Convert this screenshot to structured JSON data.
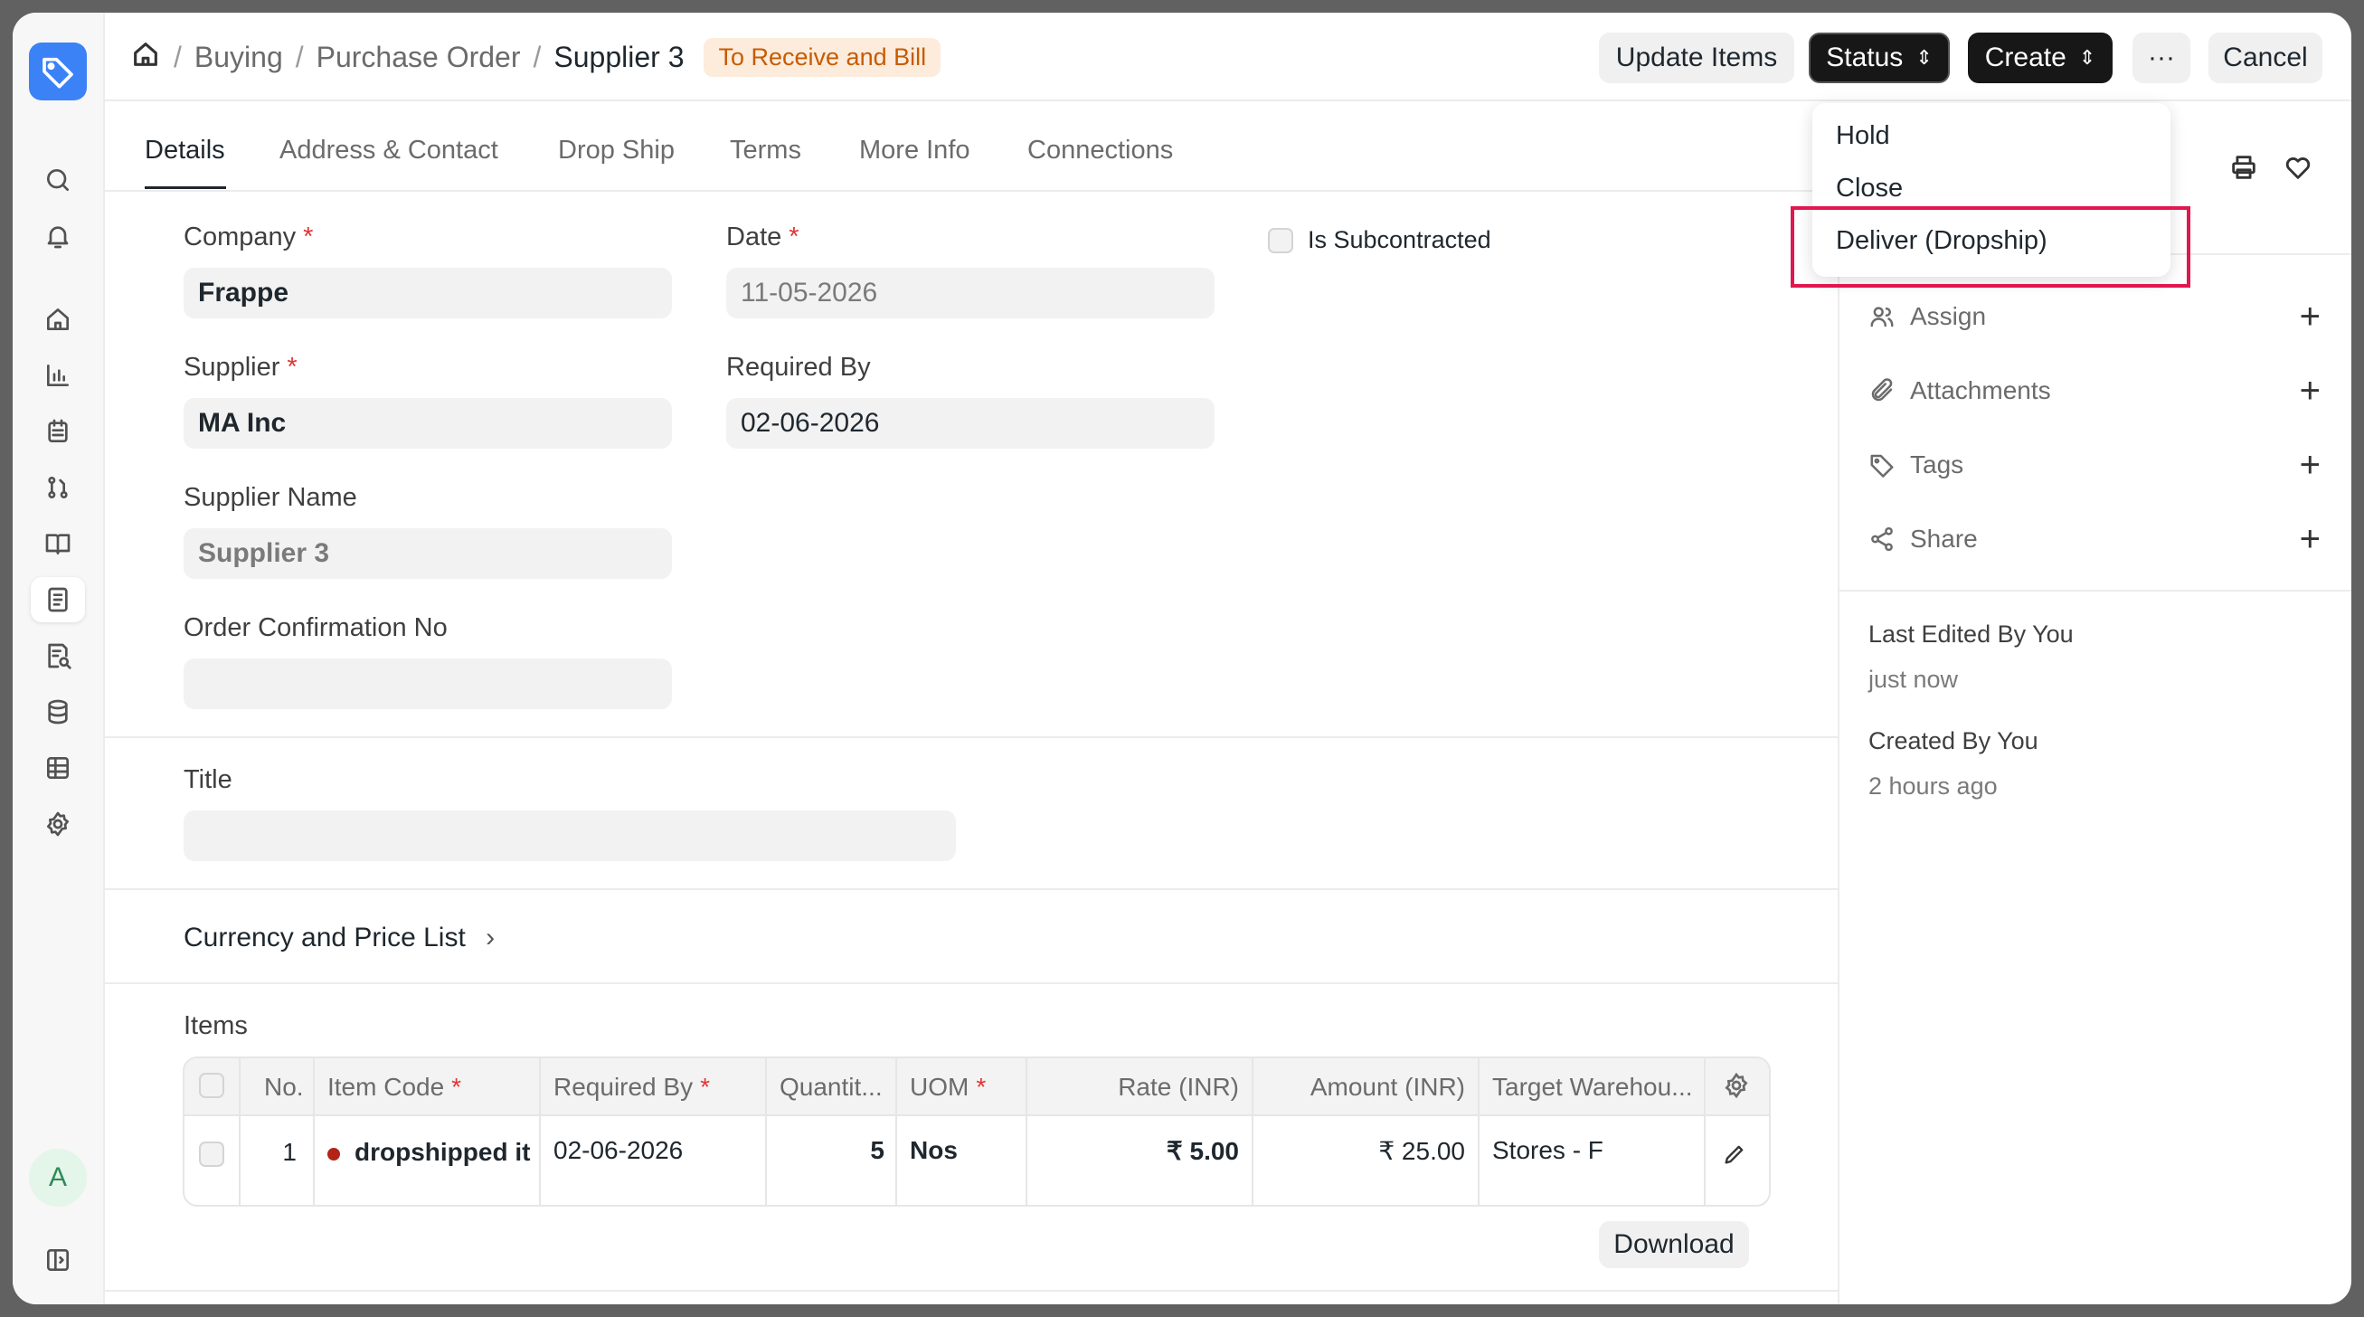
{
  "breadcrumb": {
    "items": [
      "Buying",
      "Purchase Order"
    ],
    "current": "Supplier 3",
    "status_pill": "To Receive and Bill"
  },
  "header_buttons": {
    "update_items": "Update Items",
    "status": "Status",
    "create": "Create",
    "more": "···",
    "cancel": "Cancel"
  },
  "status_menu": {
    "items": [
      "Hold",
      "Close",
      "Deliver (Dropship)"
    ],
    "highlighted": "Deliver (Dropship)"
  },
  "tabs": [
    "Details",
    "Address & Contact",
    "Drop Ship",
    "Terms",
    "More Info",
    "Connections"
  ],
  "form": {
    "company_label": "Company",
    "company_value": "Frappe",
    "date_label": "Date",
    "date_value": "11-05-2026",
    "is_subcontracted_label": "Is Subcontracted",
    "supplier_label": "Supplier",
    "supplier_value": "MA Inc",
    "required_by_label": "Required By",
    "required_by_value": "02-06-2026",
    "supplier_name_label": "Supplier Name",
    "supplier_name_value": "Supplier 3",
    "order_confirmation_label": "Order Confirmation No",
    "order_confirmation_value": "",
    "title_label": "Title",
    "title_value": "",
    "required_marker": "*"
  },
  "currency_section": "Currency and Price List",
  "items_section": {
    "label": "Items",
    "columns": [
      "No.",
      "Item Code",
      "Required By",
      "Quantit...",
      "UOM",
      "Rate (INR)",
      "Amount (INR)",
      "Target Warehou..."
    ],
    "rows": [
      {
        "no": "1",
        "item_code": "dropshipped it",
        "required_by": "02-06-2026",
        "quantity": "5",
        "uom": "Nos",
        "rate": "₹ 5.00",
        "amount": "₹ 25.00",
        "warehouse": "Stores - F"
      }
    ],
    "download": "Download"
  },
  "right_sidebar": {
    "assign": "Assign",
    "attachments": "Attachments",
    "tags": "Tags",
    "share": "Share",
    "last_edited": "Last Edited By You",
    "last_edited_time": "just now",
    "created": "Created By You",
    "created_time": "2 hours ago"
  },
  "user": {
    "avatar_letter": "A"
  },
  "colors": {
    "accent": "#3b82f6",
    "status_pill_bg": "#fdecdc",
    "status_pill_text": "#c75b00",
    "highlight": "#e0184e"
  }
}
